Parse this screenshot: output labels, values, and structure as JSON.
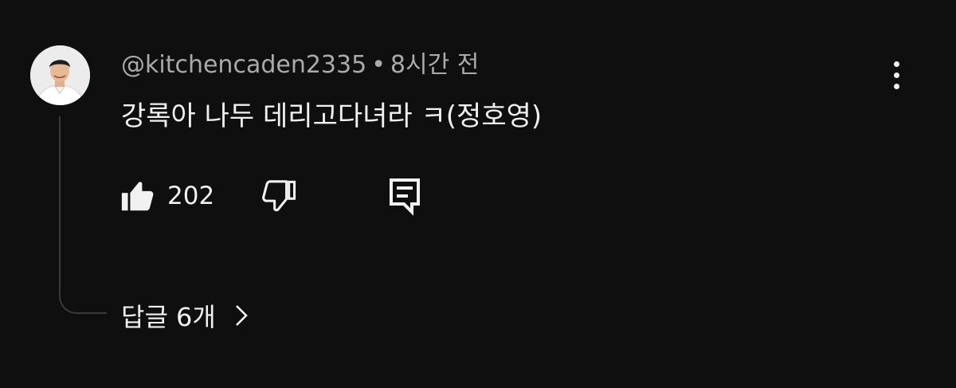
{
  "comment": {
    "author": "@kitchencaden2335",
    "separator": "•",
    "time": "8시간 전",
    "text": "강록아 나두 데리고다녀라 ㅋ(정호영)",
    "like_count": "202",
    "replies_label": "답글 6개",
    "icons": {
      "avatar": "avatar-photo",
      "more": "more-vert-icon",
      "like": "thumb-up-icon",
      "dislike": "thumb-down-icon",
      "reply": "comment-reply-icon",
      "chevron": "chevron-right-icon"
    }
  }
}
